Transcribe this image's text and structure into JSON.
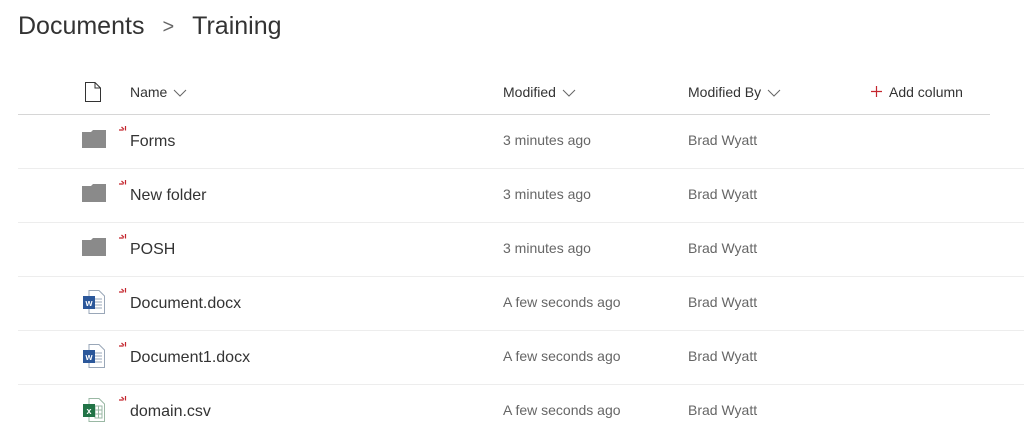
{
  "breadcrumb": {
    "root": "Documents",
    "separator": ">",
    "current": "Training"
  },
  "columns": {
    "name": "Name",
    "modified": "Modified",
    "modified_by": "Modified By",
    "add_column": "Add column"
  },
  "rows": [
    {
      "name": "Forms",
      "type": "folder-icon",
      "modified": "3 minutes ago",
      "modified_by": "Brad Wyatt"
    },
    {
      "name": "New folder",
      "type": "folder-icon",
      "modified": "3 minutes ago",
      "modified_by": "Brad Wyatt"
    },
    {
      "name": "POSH",
      "type": "folder-icon",
      "modified": "3 minutes ago",
      "modified_by": "Brad Wyatt"
    },
    {
      "name": "Document.docx",
      "type": "word-file-icon",
      "modified": "A few seconds ago",
      "modified_by": "Brad Wyatt"
    },
    {
      "name": "Document1.docx",
      "type": "word-file-icon",
      "modified": "A few seconds ago",
      "modified_by": "Brad Wyatt"
    },
    {
      "name": "domain.csv",
      "type": "excel-file-icon",
      "modified": "A few seconds ago",
      "modified_by": "Brad Wyatt"
    }
  ],
  "colors": {
    "folder": "#8a8a8a",
    "word": "#2b579a",
    "excel": "#217346",
    "new_marker": "#c4262e",
    "add_plus": "#c4262e"
  }
}
